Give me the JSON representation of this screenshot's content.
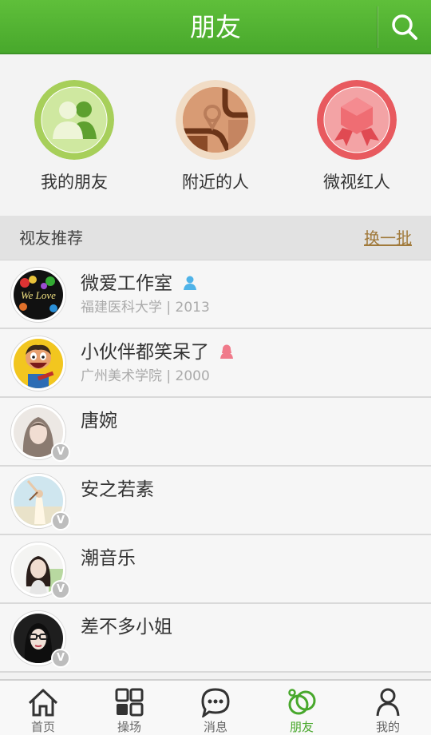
{
  "header": {
    "title": "朋友",
    "search_icon": "search-icon"
  },
  "features": [
    {
      "label": "我的朋友",
      "icon": "friends-icon"
    },
    {
      "label": "附近的人",
      "icon": "map-pin-icon"
    },
    {
      "label": "微视红人",
      "icon": "ribbon-badge-icon"
    }
  ],
  "section": {
    "title": "视友推荐",
    "refresh_label": "换一批"
  },
  "users": [
    {
      "name": "微爱工作室",
      "subtitle": "福建医科大学 | 2013",
      "gender": "male",
      "verified": false
    },
    {
      "name": "小伙伴都笑呆了",
      "subtitle": "广州美术学院 | 2000",
      "gender": "female",
      "verified": false
    },
    {
      "name": "唐婉",
      "subtitle": "",
      "verified": true,
      "badge": "V"
    },
    {
      "name": "安之若素",
      "subtitle": "",
      "verified": true,
      "badge": "V"
    },
    {
      "name": "潮音乐",
      "subtitle": "",
      "verified": true,
      "badge": "V"
    },
    {
      "name": "差不多小姐",
      "subtitle": "",
      "verified": true,
      "badge": "V"
    }
  ],
  "avatar_text": {
    "we_love": "We Love"
  },
  "tabs": [
    {
      "label": "首页",
      "icon": "home-icon",
      "active": false
    },
    {
      "label": "操场",
      "icon": "grid-icon",
      "active": false
    },
    {
      "label": "消息",
      "icon": "chat-bubble-icon",
      "active": false
    },
    {
      "label": "朋友",
      "icon": "friends-rings-icon",
      "active": true
    },
    {
      "label": "我的",
      "icon": "person-icon",
      "active": false
    }
  ],
  "colors": {
    "brand_green": "#4cae2f",
    "link_gold": "#a0793a",
    "male_blue": "#4fb3e8",
    "female_pink": "#f07a8a"
  }
}
